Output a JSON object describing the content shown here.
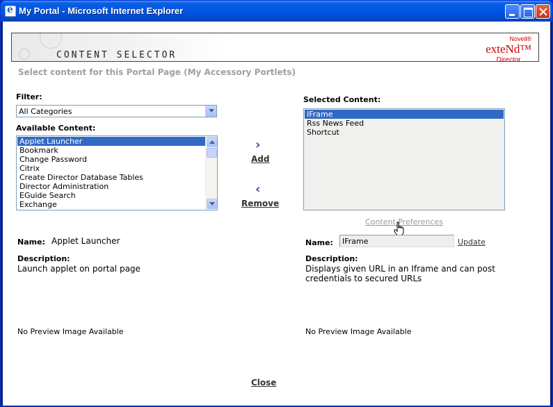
{
  "window": {
    "title": "My Portal - Microsoft Internet Explorer"
  },
  "banner": {
    "title": "CONTENT SELECTOR",
    "logo_top": "Novell®",
    "logo_main": "exteNd™",
    "logo_sub": "Director"
  },
  "subtitle": "Select content for this Portal Page (My Accessory Portlets)",
  "filter": {
    "label": "Filter:",
    "value": "All Categories"
  },
  "available": {
    "label": "Available Content:",
    "items": [
      "Applet Launcher",
      "Bookmark",
      "Change Password",
      "Citrix",
      "Create Director Database Tables",
      "Director Administration",
      "EGuide Search",
      "Exchange"
    ],
    "selected_index": 0
  },
  "selected": {
    "label": "Selected Content:",
    "items": [
      "IFrame",
      "Rss News Feed",
      "Shortcut"
    ],
    "selected_index": 0
  },
  "actions": {
    "add_label": "Add",
    "remove_label": "Remove",
    "close_label": "Close",
    "content_preferences": "Content Preferences",
    "update_label": "Update"
  },
  "left_detail": {
    "name_label": "Name:",
    "name_value": "Applet Launcher",
    "description_label": "Description:",
    "description": "Launch applet on portal page",
    "preview": "No Preview Image Available"
  },
  "right_detail": {
    "name_label": "Name:",
    "name_value": "IFrame",
    "description_label": "Description:",
    "description_line1": "Displays given URL in an Iframe and can post",
    "description_line2": "credentials to secured URLs",
    "preview": "No Preview Image Available"
  }
}
